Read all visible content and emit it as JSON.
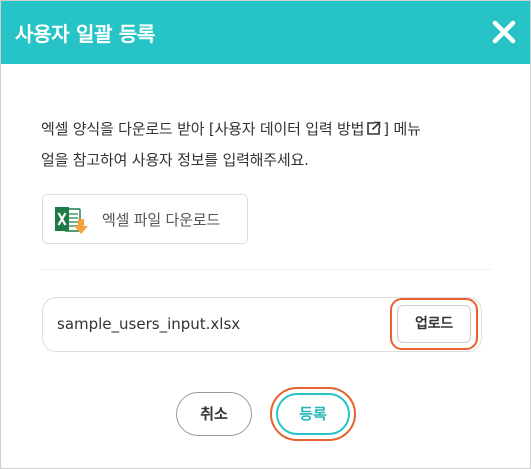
{
  "dialog": {
    "title": "사용자 일괄 등록",
    "close_icon": "close-x-icon"
  },
  "instruction": {
    "prefix": "엑셀 양식을 다운로드 받아 [",
    "link_text": "사용자 데이터 입력 방법",
    "link_icon": "external-link-icon",
    "suffix_line1": "] 메뉴",
    "line2": "얼을 참고하여 사용자 정보를 입력해주세요."
  },
  "excel_download": {
    "icon": "excel-download-icon",
    "label": "엑셀 파일 다운로드"
  },
  "upload": {
    "file_name": "sample_users_input.xlsx",
    "button_label": "업로드"
  },
  "actions": {
    "cancel_label": "취소",
    "register_label": "등록"
  },
  "colors": {
    "header": "#27c4c7",
    "highlight": "#e8612e",
    "excel_green": "#1f7a45",
    "download_orange": "#f5a23a"
  }
}
